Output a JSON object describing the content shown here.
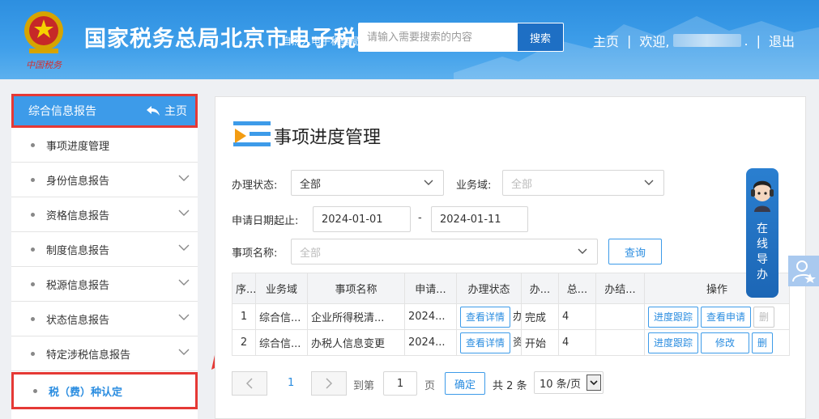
{
  "header": {
    "title": "国家税务总局北京市电子税",
    "subtitle": "自然人电子税务局",
    "search_placeholder": "请输入需要搜索的内容",
    "search_button": "搜索",
    "nav_home": "主页",
    "nav_welcome": "欢迎,",
    "nav_dot": ".",
    "nav_sep": "|",
    "nav_logout": "退出",
    "emblem_text": "中国税务"
  },
  "sidebar": {
    "head_label": "综合信息报告",
    "head_home": "主页",
    "items": [
      {
        "label": "事项进度管理",
        "expandable": false
      },
      {
        "label": "身份信息报告",
        "expandable": true
      },
      {
        "label": "资格信息报告",
        "expandable": true
      },
      {
        "label": "制度信息报告",
        "expandable": true
      },
      {
        "label": "税源信息报告",
        "expandable": true
      },
      {
        "label": "状态信息报告",
        "expandable": true
      },
      {
        "label": "特定涉税信息报告",
        "expandable": true
      },
      {
        "label": "税（费）种认定",
        "expandable": false
      }
    ]
  },
  "main": {
    "title": "事项进度管理",
    "filters": {
      "status_label": "办理状态:",
      "status_value": "全部",
      "domain_label": "业务域:",
      "domain_placeholder": "全部",
      "date_label": "申请日期起止:",
      "date_from": "2024-01-01",
      "date_dash": "-",
      "date_to": "2024-01-11",
      "item_label": "事项名称:",
      "item_placeholder": "全部",
      "query_button": "查询"
    },
    "table": {
      "columns": [
        "序...",
        "业务域",
        "事项名称",
        "申请...",
        "办理状态",
        "办...",
        "总...",
        "办结...",
        "操作"
      ],
      "rows": [
        {
          "no": "1",
          "domain": "综合信...",
          "name": "企业所得税清...",
          "date": "2024...",
          "detail": "查看详情",
          "status_tail": "办",
          "state": "完成",
          "total": "4",
          "done": "",
          "ops": [
            "进度跟踪",
            "查看申请",
            "删"
          ],
          "last_disabled": true
        },
        {
          "no": "2",
          "domain": "综合信...",
          "name": "办税人信息变更",
          "date": "2024...",
          "detail": "查看详情",
          "status_tail": "资",
          "state": "开始",
          "total": "4",
          "done": "",
          "ops": [
            "进度跟踪",
            "修改",
            "删"
          ],
          "last_disabled": false
        }
      ]
    },
    "pagination": {
      "current": "1",
      "goto_label": "到第",
      "goto_value": "1",
      "page_unit": "页",
      "confirm": "确定",
      "total": "共 2 条",
      "page_size": "10 条/页"
    }
  },
  "guide": {
    "label": "在线导办"
  },
  "colors": {
    "header_blue": "#3d9be9",
    "accent": "#2b8de0",
    "highlight_red": "#e53935",
    "guide_blue": "#1c66b5"
  }
}
